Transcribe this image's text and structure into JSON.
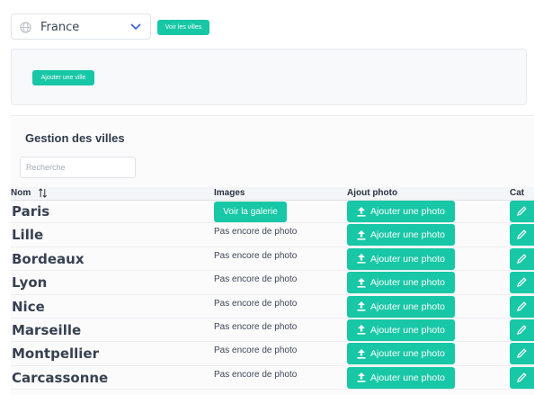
{
  "country_select": {
    "value": "France",
    "icon": "globe-icon"
  },
  "buttons": {
    "voir_villes": "Voir les villes",
    "ajouter_ville": "Ajouter une ville"
  },
  "manage": {
    "title": "Gestion des villes",
    "search_placeholder": "Recherche"
  },
  "table": {
    "headers": {
      "nom": "Nom",
      "images": "Images",
      "ajout_photo": "Ajout photo",
      "cat": "Cat"
    },
    "rows": [
      {
        "city": "Paris",
        "images": "Voir la galerie",
        "has_gallery": true,
        "upload": "Ajouter une photo"
      },
      {
        "city": "Lille",
        "images": "Pas encore de photo",
        "has_gallery": false,
        "upload": "Ajouter une photo"
      },
      {
        "city": "Bordeaux",
        "images": "Pas encore de photo",
        "has_gallery": false,
        "upload": "Ajouter une photo"
      },
      {
        "city": "Lyon",
        "images": "Pas encore de photo",
        "has_gallery": false,
        "upload": "Ajouter une photo"
      },
      {
        "city": "Nice",
        "images": "Pas encore de photo",
        "has_gallery": false,
        "upload": "Ajouter une photo"
      },
      {
        "city": "Marseille",
        "images": "Pas encore de photo",
        "has_gallery": false,
        "upload": "Ajouter une photo"
      },
      {
        "city": "Montpellier",
        "images": "Pas encore de photo",
        "has_gallery": false,
        "upload": "Ajouter une photo"
      },
      {
        "city": "Carcassonne",
        "images": "Pas encore de photo",
        "has_gallery": false,
        "upload": "Ajouter une photo"
      }
    ]
  },
  "colors": {
    "accent": "#17c7a6",
    "text": "#374151"
  }
}
